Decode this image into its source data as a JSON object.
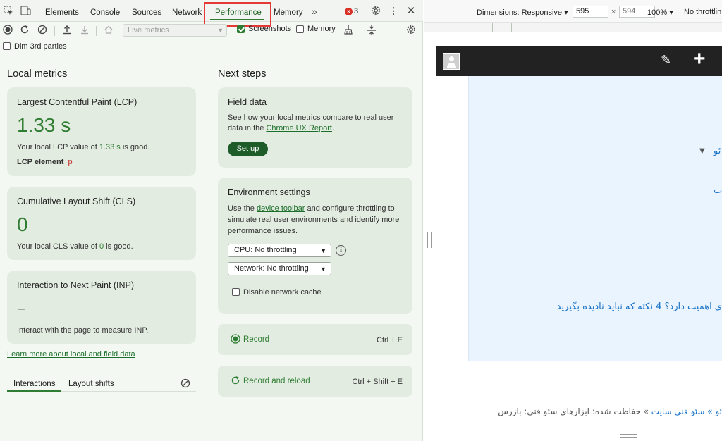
{
  "devtools": {
    "tabs": [
      "Elements",
      "Console",
      "Sources",
      "Network",
      "Performance",
      "Memory"
    ],
    "more_tabs_glyph": "»",
    "error_count": "3",
    "toolbar": {
      "live_metrics_placeholder": "Live metrics",
      "screenshots_label": "Screenshots",
      "screenshots_checked": true,
      "memory_label": "Memory",
      "memory_checked": false
    },
    "dim_3rd_parties_label": "Dim 3rd parties",
    "local_metrics": {
      "title": "Local metrics",
      "lcp": {
        "title": "Largest Contentful Paint (LCP)",
        "value": "1.33 s",
        "desc_pre": "Your local LCP value of ",
        "desc_val": "1.33 s",
        "desc_post": " is good.",
        "element_label": "LCP element",
        "element_tag": "p"
      },
      "cls": {
        "title": "Cumulative Layout Shift (CLS)",
        "value": "0",
        "desc_pre": "Your local CLS value of ",
        "desc_val": "0",
        "desc_post": " is good."
      },
      "inp": {
        "title": "Interaction to Next Paint (INP)",
        "value": "–",
        "desc": "Interact with the page to measure INP."
      },
      "learn_more": "Learn more about local and field data",
      "subtabs": [
        "Interactions",
        "Layout shifts"
      ]
    },
    "next_steps": {
      "title": "Next steps",
      "field_data": {
        "title": "Field data",
        "desc_line1": "See how your local metrics compare to real user",
        "desc_line2_pre": "data in the ",
        "desc_link": "Chrome UX Report",
        "desc_line2_post": ".",
        "button": "Set up"
      },
      "environment": {
        "title": "Environment settings",
        "desc_pre": "Use the ",
        "desc_link": "device toolbar",
        "desc_post1": " and configure throttling to",
        "desc_line2": "simulate real user environments and identify more",
        "desc_line3": "performance issues.",
        "cpu_select": "CPU: No throttling",
        "network_select": "Network: No throttling",
        "disable_cache_label": "Disable network cache",
        "disable_cache_checked": false
      },
      "record": {
        "label": "Record",
        "shortcut": "Ctrl + E"
      },
      "record_reload": {
        "label": "Record and reload",
        "shortcut": "Ctrl + Shift + E"
      }
    }
  },
  "emulation": {
    "dimensions_label": "Dimensions: Responsive ▾",
    "width": "595",
    "height": "594",
    "times": "×",
    "zoom": "100% ▾",
    "throttle": "No throttlin"
  },
  "site": {
    "dropdown_arrow": "▼",
    "fragment1": "ئو",
    "fragment2": "ت",
    "headline": "ی اهمیت دارد؟ 4 نکته که نباید نادیده بگیرید",
    "breadcrumb_link": "ئو » سئو فنی سایت",
    "breadcrumb_rest": " » حفاظت شده: ابزارهای سئو فنی: بازرس"
  },
  "colors": {
    "accent_green": "#2e7d32",
    "setup_button": "#1e5d2a",
    "highlight_red": "#e53935",
    "site_link_blue": "#1a73c8"
  }
}
